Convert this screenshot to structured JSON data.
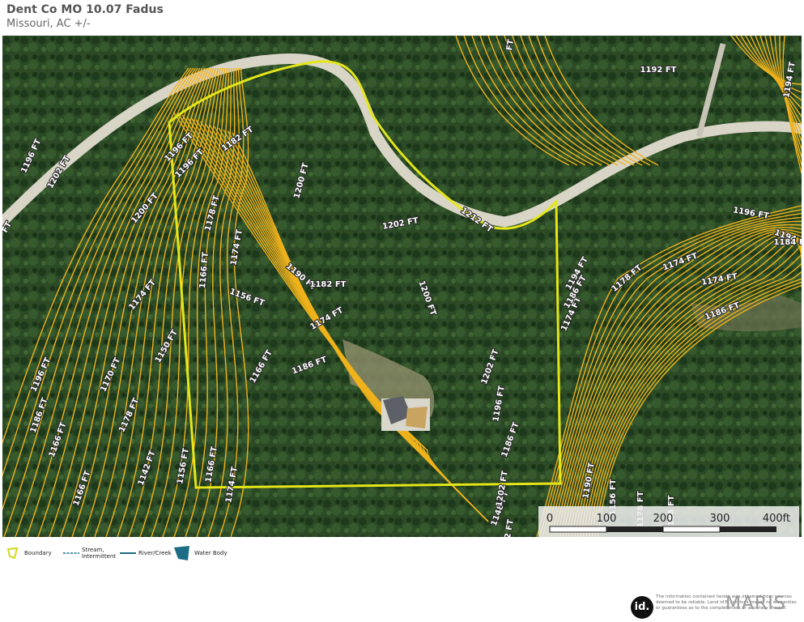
{
  "header": {
    "title": "Dent Co MO 10.07 Fadus",
    "subtitle": "Missouri,  AC +/-"
  },
  "colors": {
    "imagery_dark": "#1f3a1c",
    "imagery_mid": "#2e4d26",
    "contour": "#f0b21c",
    "boundary": "#e4e619",
    "road": "#d6d2c4",
    "water": "#1d6c86"
  },
  "contour_labels": [
    "1196 FT",
    "1202 FT",
    "1200 FT",
    "1196 FT",
    "1182 FT",
    "1200 FT",
    "1178 FT",
    "1174 FT",
    "1196 FT",
    "1166 FT",
    "1190 FT",
    "1212 FT",
    "1202 FT",
    "1200 FT",
    "1182 FT",
    "1156 FT",
    "1174 FT",
    "1174 FT",
    "1150 FT",
    "1196 FT",
    "1170 FT",
    "1186 FT",
    "1178 FT",
    "1186 FT",
    "1202 FT",
    "1196 FT",
    "1166 FT",
    "1142 FT",
    "1156 FT",
    "1166 FT",
    "1174 FT",
    "1174 FT",
    "1166 FT",
    "1166 FT",
    "1186 FT",
    "1194 FT",
    "1148 FT",
    "1172 FT",
    "1194 FT",
    "1186 FT",
    "1178 FT",
    "1174 FT",
    "1174 FT",
    "1186 FT",
    "1196 FT",
    "1184 FT",
    "1194 FT",
    "1192 FT",
    "1190 FT",
    "1156 FT",
    "1178 FT",
    "1188 FT",
    "1202 FT",
    "FT",
    "FT"
  ],
  "scale": {
    "ticks": [
      "0",
      "100",
      "200",
      "300",
      "400ft"
    ]
  },
  "legend": [
    {
      "label": "Boundary",
      "icon": "boundary-polygon-icon"
    },
    {
      "label": "Stream,",
      "label2": "Intermittent",
      "icon": "stream-intermittent-line-icon"
    },
    {
      "label": "River/Creek",
      "icon": "river-creek-line-icon"
    },
    {
      "label": "Water Body",
      "icon": "water-body-polygon-icon"
    }
  ],
  "footer": {
    "logo": "id.",
    "disclaimer": "The information contained herein was obtained from sources deemed to be reliable. Land id® Services makes no warranties or guarantees as to the completeness or accuracy thereof.",
    "watermark": "MARIS"
  }
}
